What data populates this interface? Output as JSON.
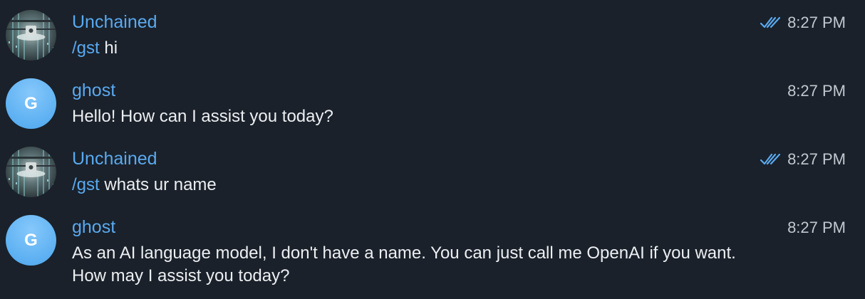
{
  "messages": [
    {
      "sender": "Unchained",
      "avatar_type": "image",
      "command": "/gst",
      "text": " hi",
      "time": "8:27 PM",
      "read": true
    },
    {
      "sender": "ghost",
      "avatar_type": "letter",
      "avatar_letter": "G",
      "text": "Hello! How can I assist you today?",
      "time": "8:27 PM",
      "read": false
    },
    {
      "sender": "Unchained",
      "avatar_type": "image",
      "command": "/gst",
      "text": " whats ur name",
      "time": "8:27 PM",
      "read": true
    },
    {
      "sender": "ghost",
      "avatar_type": "letter",
      "avatar_letter": "G",
      "text": "As an AI language model, I don't have a name. You can just call me OpenAI if you want. How may I assist you today?",
      "time": "8:27 PM",
      "read": false
    }
  ],
  "colors": {
    "background": "#1a212a",
    "accent": "#5aa9f0",
    "text": "#eceff2",
    "time": "#c2c8cf",
    "avatar_letter_bg": "#4ba6ee"
  },
  "icons": {
    "read_status": "double-check-icon"
  }
}
